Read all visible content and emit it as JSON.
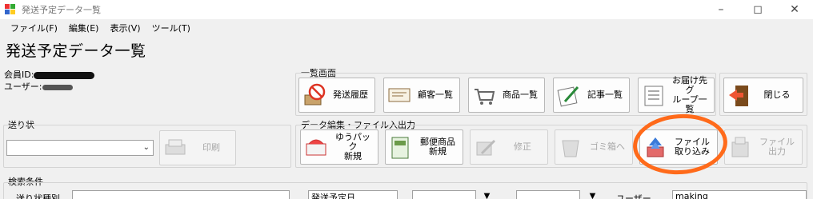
{
  "window": {
    "title": "発送予定データ一覧",
    "minimize_icon": "minimize-icon",
    "maximize_icon": "maximize-icon",
    "close_icon": "close-icon"
  },
  "menu": [
    "ファイル(F)",
    "編集(E)",
    "表示(V)",
    "ツール(T)"
  ],
  "page_title": "発送予定データ一覧",
  "user_info": {
    "member_id_label": "会員ID:",
    "user_label": "ユーザー:"
  },
  "list_group": {
    "label": "一覧画面",
    "buttons": [
      {
        "label": "発送履歴",
        "icon": "prohibited-shipping-icon",
        "enabled": true
      },
      {
        "label": "顧客一覧",
        "icon": "card-icon",
        "enabled": true
      },
      {
        "label": "商品一覧",
        "icon": "cart-icon",
        "enabled": true
      },
      {
        "label": "記事一覧",
        "icon": "notebook-pen-icon",
        "enabled": true
      },
      {
        "label": "お届け先グ\nループ一覧",
        "icon": "list-icon",
        "enabled": true
      },
      {
        "label": "閉じる",
        "icon": "exit-door-icon",
        "enabled": true
      }
    ]
  },
  "slip_group": {
    "label": "送り状",
    "select_value": "",
    "print_label": "印刷",
    "print_icon": "printer-icon"
  },
  "edit_group": {
    "label": "データ編集・ファイル入出力",
    "buttons": [
      {
        "label": "ゆうパック\n新規",
        "icon": "package-icon",
        "enabled": true
      },
      {
        "label": "郵便商品\n新規",
        "icon": "mail-product-icon",
        "enabled": true
      },
      {
        "label": "修正",
        "icon": "edit-icon",
        "enabled": false
      },
      {
        "label": "ゴミ箱へ",
        "icon": "trash-icon",
        "enabled": false
      },
      {
        "label": "ファイル\n取り込み",
        "icon": "file-import-icon",
        "enabled": true
      },
      {
        "label": "ファイル\n出力",
        "icon": "file-export-icon",
        "enabled": false
      }
    ]
  },
  "search": {
    "label": "検索条件",
    "row_label_1": "送り状種別",
    "select_2": "発送予定日",
    "user_label": "ユーザー",
    "user_value": "making"
  },
  "colors": {
    "highlight": "#ff6a1a"
  }
}
